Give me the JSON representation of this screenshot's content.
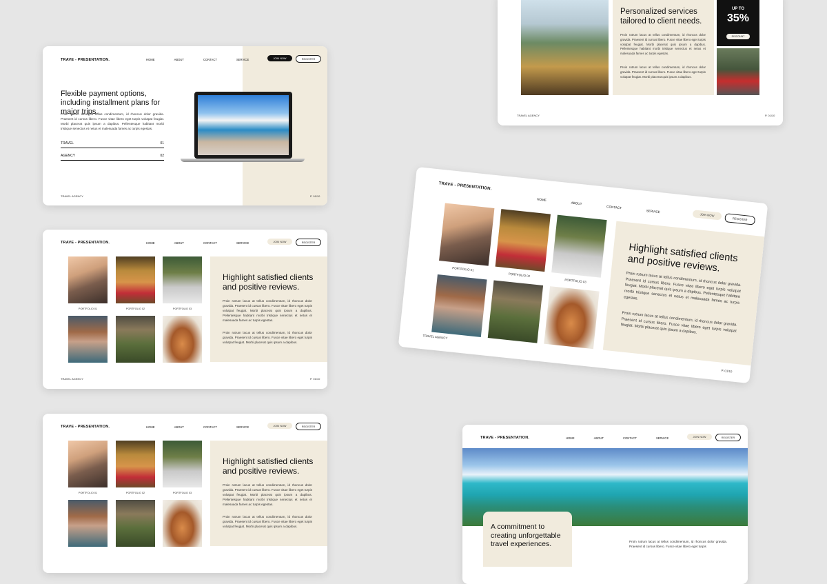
{
  "brand": "TRAVE - PRESENTATION.",
  "brand_alt": "TRAVE - PRESENTATION.",
  "nav": [
    "HOME",
    "ABOUT",
    "CONTACT",
    "SERVICE"
  ],
  "join_label": "JOIN NOW",
  "register_label": "REGISTER",
  "footer_left": "TRAVEL AGENCY",
  "footer_left_alt": "TRAVEL AGENCY",
  "footer_right": "P. 01/10",
  "slide_payment": {
    "heading": "Flexible payment options, including installment plans for major trips.",
    "body": "Proin rutrum lacus at tellus condimentum, id rhoncus dolor gravida. Praesent id cursus libero. Fusce vitae libero eget turpis volutpat feugiat. Morbi placerat quis ipsum a dapibus. Pellentesque habitant morbi tristique senectus et netus et malesuada fames ac turpis egestas.",
    "rows": [
      {
        "label": "TRAVEL",
        "num": "01"
      },
      {
        "label": "AGENCY",
        "num": "02"
      }
    ]
  },
  "slide_services": {
    "heading": "Personalized services tailored to client needs.",
    "body1": "Proin rutrum lacus at tellus condimentum, id rhoncus dolor gravida. Praesent id cursus libero. Fusce vitae libero eget turpis volutpat feugiat. Morbi placerat quis ipsum a dapibus. Pellentesque habitant morbi tristique senectus et netus et malesuada fames ac turpis egestas.",
    "body2": "Proin rutrum lacus at tellus condimentum, id rhoncus dolor gravida. Praesent id cursus libero. Fusce vitae libero eget turpis volutpat feugiat. Morbi placerat quis ipsum a dapibus.",
    "promo_top": "UP TO",
    "promo_value": "35%",
    "promo_button": "DISCOUNT"
  },
  "slide_reviews": {
    "heading": "Highlight satisfied clients and positive reviews.",
    "body1": "Proin rutrum lacus at tellus condimentum, id rhoncus dolor gravida. Praesent id cursus libero. Fusce vitae libero eget turpis volutpat feugiat. Morbi placerat quis ipsum a dapibus. Pellentesque habitant morbi tristique senectus et netus et malesuada fames ac turpis egestas.",
    "body2": "Proin rutrum lacus at tellus condimentum, id rhoncus dolor gravida. Praesent id cursus libero. Fusce vitae libero eget turpis volutpat feugiat. Morbi placerat quis ipsum a dapibus.",
    "captions": [
      "PORTFOLIO 01",
      "PORTFOLIO 02",
      "PORTFOLIO 03"
    ]
  },
  "slide_commitment": {
    "heading": "A commitment to creating unforgettable travel experiences.",
    "body": "Proin rutrum lacus at tellus condimentum, id rhoncus dolor gravida. Praesent id cursus libero. Fusce vitae libero eget turpis"
  },
  "colors": {
    "background": "#e6e6e6",
    "beige": "#f1ebdd",
    "dark": "#111111"
  }
}
